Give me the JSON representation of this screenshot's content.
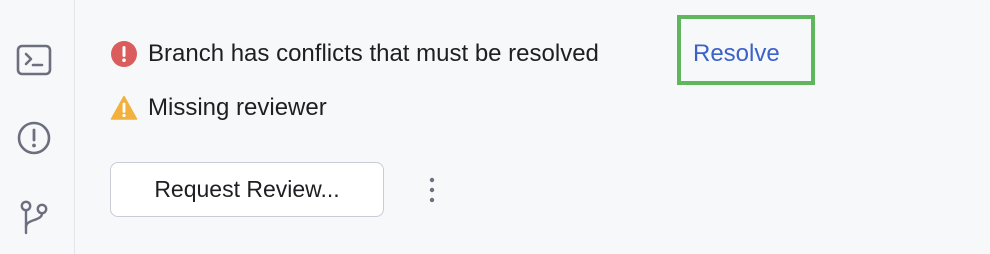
{
  "sidebar": {
    "items": [
      {
        "icon": "terminal-icon"
      },
      {
        "icon": "problems-icon"
      },
      {
        "icon": "branch-icon"
      }
    ]
  },
  "status": {
    "conflicts": {
      "icon": "error-icon",
      "text": "Branch has conflicts that must be resolved",
      "action_label": "Resolve"
    },
    "reviewer": {
      "icon": "warning-icon",
      "text": "Missing reviewer"
    }
  },
  "actions": {
    "request_review_label": "Request Review...",
    "more_icon": "more-vertical-icon"
  },
  "colors": {
    "background": "#f7f8fa",
    "error": "#db5c5c",
    "warning": "#f2b13c",
    "link": "#3c62c9",
    "highlight": "#5fb65d",
    "icon": "#6c707e"
  }
}
